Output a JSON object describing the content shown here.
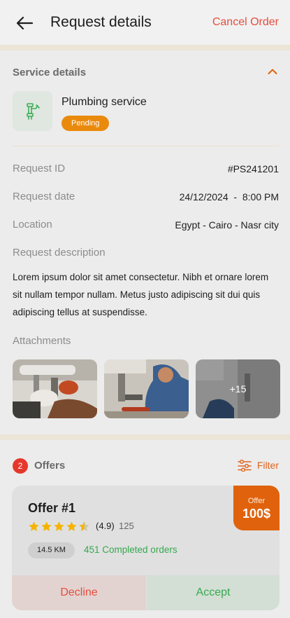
{
  "header": {
    "title": "Request details",
    "cancel_label": "Cancel Order"
  },
  "service": {
    "section_title": "Service details",
    "name": "Plumbing service",
    "status": "Pending",
    "rows": [
      {
        "label": "Request ID",
        "value": "#PS241201"
      },
      {
        "label": "Request date",
        "value": "24/12/2024  -  8:00 PM"
      },
      {
        "label": "Location",
        "value": "Egypt - Cairo - Nasr city"
      }
    ],
    "description_label": "Request description",
    "description": "Lorem ipsum dolor sit amet consectetur. Nibh et ornare lorem sit nullam tempor nullam. Metus justo adipiscing sit dui quis adipiscing tellus at suspendisse.",
    "attachments_label": "Attachments",
    "attachments_more": "+15"
  },
  "offers": {
    "count": "2",
    "title": "Offers",
    "filter_label": "Filter",
    "items": [
      {
        "title": "Offer #1",
        "rating": "(4.9)",
        "stars": 4.5,
        "reviews": "125",
        "distance": "14.5 KM",
        "completed": "451 Completed orders",
        "price_label": "Offer",
        "price": "100$",
        "decline_label": "Decline",
        "accept_label": "Accept"
      }
    ]
  },
  "colors": {
    "accent": "#e0620c",
    "danger": "#e64c3c",
    "success": "#36a850",
    "pending": "#ea8a0d"
  }
}
